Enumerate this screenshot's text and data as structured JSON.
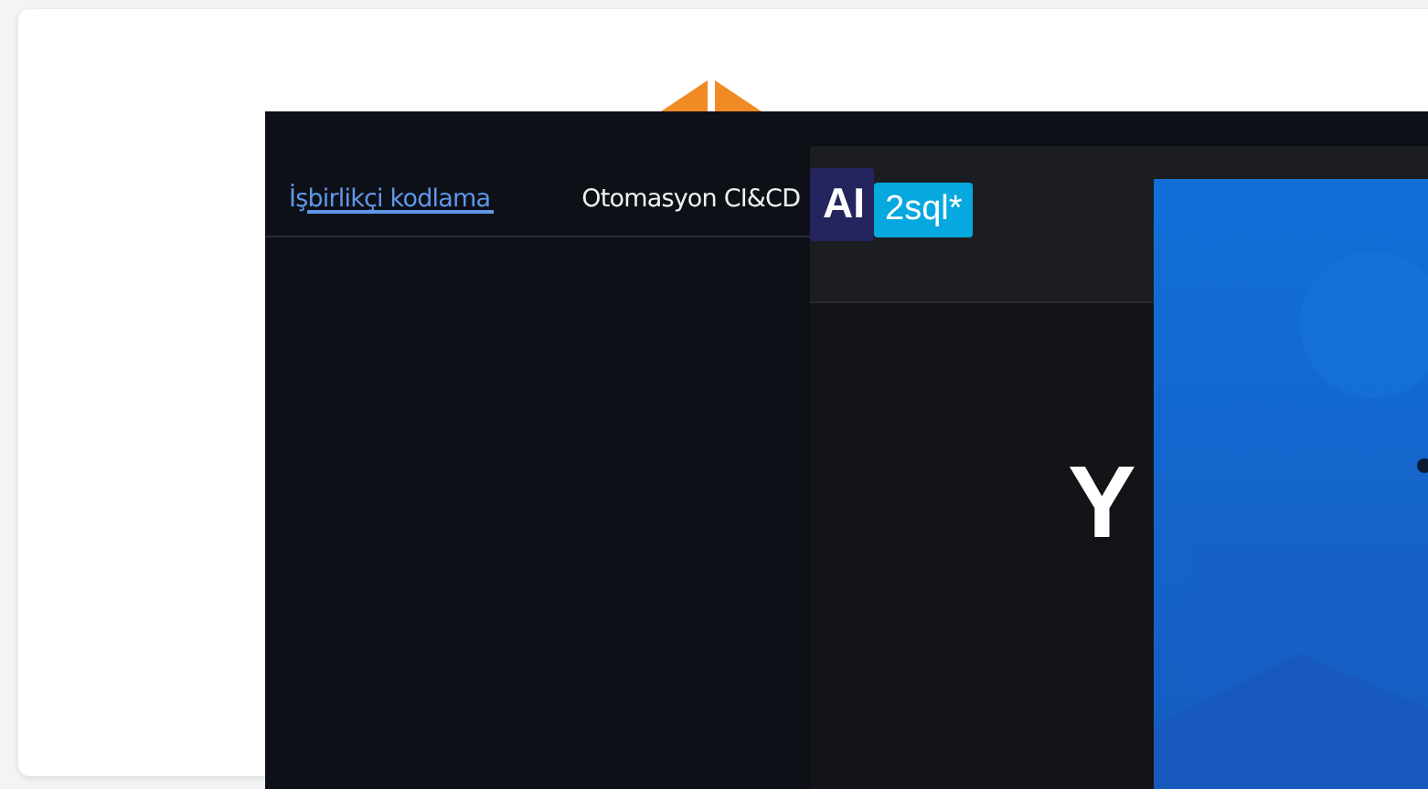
{
  "tabs": [
    {
      "label": "İşbirlikçi kodlama",
      "selected": true
    },
    {
      "label": "Otomasyon CI&CD",
      "selected": false
    }
  ],
  "app": {
    "logo": {
      "left": "AI",
      "right": "2sql*"
    },
    "headline": "Y"
  }
}
